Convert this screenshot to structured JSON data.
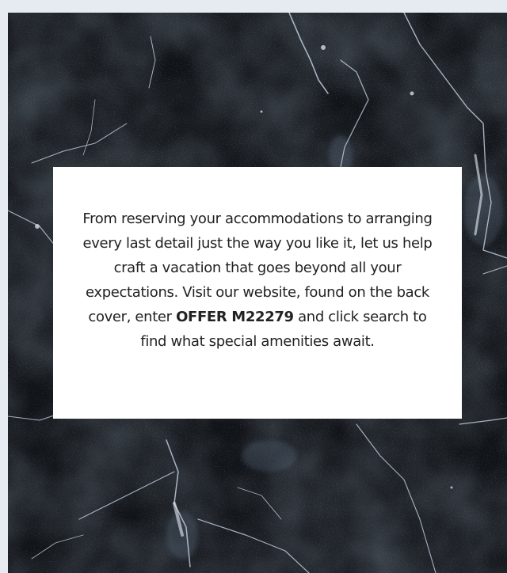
{
  "card": {
    "text_before": "From reserving your accommodations to arranging every last detail just the way you like it, let us help craft a vacation that goes beyond all your expectations. Visit our website, found on the back cover, enter ",
    "offer_code": "OFFER M22279",
    "text_after": " and click search to find what special amenities await."
  },
  "colors": {
    "background": "#e6ebf2",
    "marble_dark": "#111418",
    "vein": "#c9d6e6",
    "card": "#ffffff",
    "text": "#222222"
  }
}
